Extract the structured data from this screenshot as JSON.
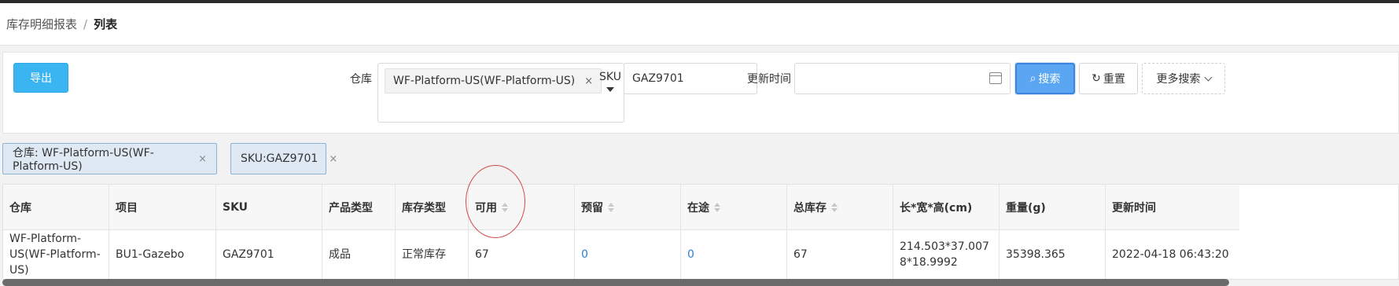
{
  "breadcrumb": {
    "parent": "库存明细报表",
    "separator": "/",
    "current": "列表"
  },
  "search": {
    "export_label": "导出",
    "warehouse_label": "仓库",
    "warehouse_value": "WF-Platform-US(WF-Platform-US)",
    "warehouse_remove": "×",
    "sku_label": "SKU",
    "sku_value": "GAZ9701",
    "update_time_label": "更新时间",
    "update_time_value": "",
    "search_label": "搜索",
    "reset_label": "重置",
    "more_label": "更多搜索"
  },
  "active_filters": [
    {
      "label": "仓库: WF-Platform-US(WF-Platform-US)",
      "remove": "×"
    },
    {
      "label": "SKU:GAZ9701",
      "remove": "×"
    }
  ],
  "table": {
    "columns": [
      "仓库",
      "项目",
      "SKU",
      "产品类型",
      "库存类型",
      "可用",
      "预留",
      "在途",
      "总库存",
      "长*宽*高(cm)",
      "重量(g)",
      "更新时间"
    ],
    "rows": [
      {
        "warehouse": "WF-Platform-US(WF-Platform-US)",
        "project": "BU1-Gazebo",
        "sku": "GAZ9701",
        "product_type": "成品",
        "stock_type": "正常库存",
        "available": "67",
        "reserved": "0",
        "in_transit": "0",
        "total": "67",
        "dimensions": "214.503*37.0078*18.9992",
        "weight": "35398.365",
        "updated": "2022-04-18 06:43:20"
      }
    ]
  },
  "colors": {
    "primary": "#3bb4f2",
    "search_button": "#5aa6f2",
    "link": "#2f7fd1",
    "annotation_circle": "#d24a4a"
  }
}
